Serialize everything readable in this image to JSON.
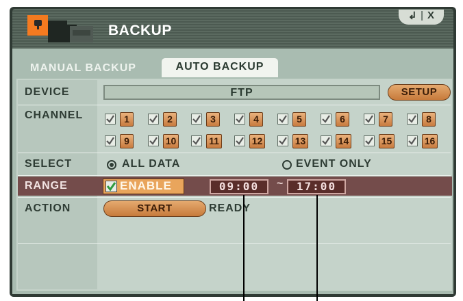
{
  "window": {
    "title": "BACKUP",
    "controls": {
      "enter_symbol": "↲",
      "close_symbol": "X"
    }
  },
  "tabs": [
    {
      "label": "MANUAL BACKUP",
      "active": false
    },
    {
      "label": "AUTO BACKUP",
      "active": true
    }
  ],
  "device": {
    "label": "DEVICE",
    "value": "FTP",
    "setup_label": "SETUP"
  },
  "channel": {
    "label": "CHANNEL",
    "channels": [
      {
        "n": "1",
        "checked": true
      },
      {
        "n": "2",
        "checked": true
      },
      {
        "n": "3",
        "checked": true
      },
      {
        "n": "4",
        "checked": true
      },
      {
        "n": "5",
        "checked": true
      },
      {
        "n": "6",
        "checked": true
      },
      {
        "n": "7",
        "checked": true
      },
      {
        "n": "8",
        "checked": true
      },
      {
        "n": "9",
        "checked": true
      },
      {
        "n": "10",
        "checked": true
      },
      {
        "n": "11",
        "checked": true
      },
      {
        "n": "12",
        "checked": true
      },
      {
        "n": "13",
        "checked": true
      },
      {
        "n": "14",
        "checked": true
      },
      {
        "n": "15",
        "checked": true
      },
      {
        "n": "16",
        "checked": true
      }
    ]
  },
  "select": {
    "label": "SELECT",
    "options": [
      {
        "label": "ALL DATA",
        "selected": true
      },
      {
        "label": "EVENT ONLY",
        "selected": false
      }
    ]
  },
  "range": {
    "label": "RANGE",
    "enable_label": "ENABLE",
    "enabled": true,
    "start_time": "09:00",
    "separator": "~",
    "end_time": "17:00"
  },
  "action": {
    "label": "ACTION",
    "start_label": "START",
    "status": "READY"
  },
  "colors": {
    "accent_orange": "#e9a55c",
    "range_row": "#744c4b",
    "panel": "#a9bcb1",
    "check_green": "#3aa34a"
  }
}
